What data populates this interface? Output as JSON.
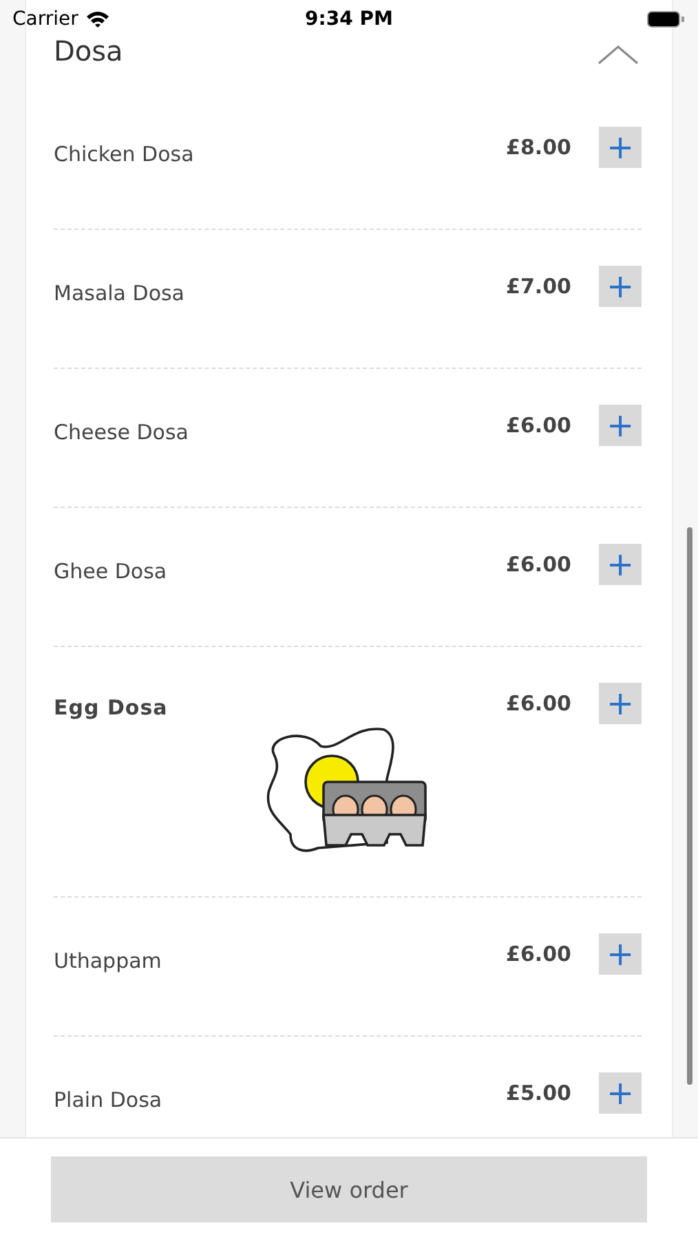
{
  "status_bar": {
    "carrier": "Carrier",
    "time": "9:34 PM"
  },
  "section": {
    "title": "Dosa",
    "expanded": true,
    "items": [
      {
        "name": "Chicken Dosa",
        "price": "£8.00",
        "kind": "plain"
      },
      {
        "name": "Masala Dosa",
        "price": "£7.00",
        "kind": "plain"
      },
      {
        "name": "Cheese Dosa",
        "price": "£6.00",
        "kind": "plain"
      },
      {
        "name": "Ghee Dosa",
        "price": "£6.00",
        "kind": "plain"
      },
      {
        "name": "Egg Dosa",
        "price": "£6.00",
        "kind": "illustrated"
      },
      {
        "name": "Uthappam",
        "price": "£6.00",
        "kind": "plain"
      },
      {
        "name": "Plain Dosa",
        "price": "£5.00",
        "kind": "plain"
      }
    ]
  },
  "add_button": "+",
  "footer_button": "View order"
}
